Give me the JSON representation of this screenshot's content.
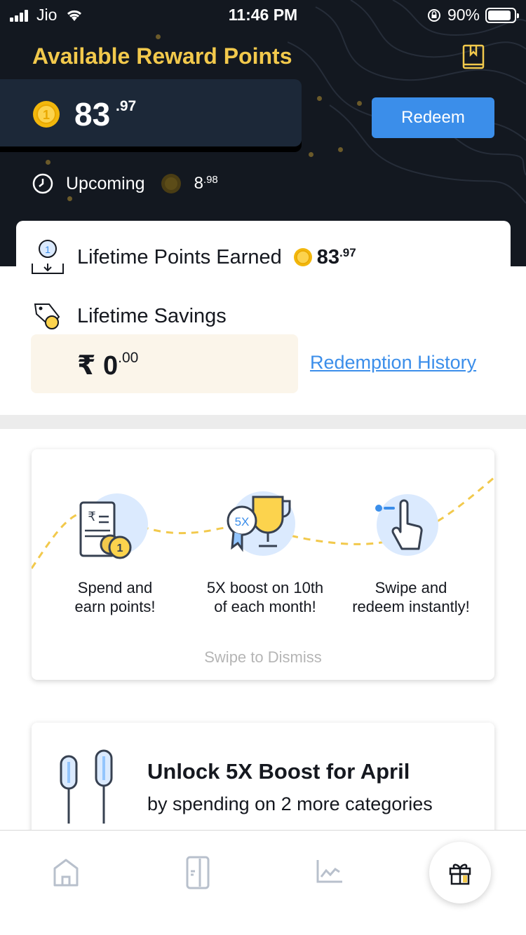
{
  "status_bar": {
    "carrier": "Jio",
    "time": "11:46 PM",
    "battery": "90%"
  },
  "rewards": {
    "title": "Available Reward Points",
    "points_int": "83",
    "points_dec": ".97",
    "redeem_label": "Redeem",
    "upcoming_label": "Upcoming",
    "upcoming_int": "8",
    "upcoming_dec": ".98"
  },
  "lifetime": {
    "points_label": "Lifetime Points Earned",
    "points_int": "83",
    "points_dec": ".97",
    "savings_label": "Lifetime Savings",
    "savings_int": "₹ 0",
    "savings_dec": ".00",
    "history_link": "Redemption History"
  },
  "how_it_works": {
    "steps": [
      {
        "line1": "Spend and",
        "line2": "earn points!",
        "icon": "receipt-coin-icon"
      },
      {
        "line1": "5X boost on 10th",
        "line2": "of each month!",
        "icon": "trophy-5x-icon",
        "badge": "5X"
      },
      {
        "line1": "Swipe and",
        "line2": "redeem instantly!",
        "icon": "swipe-hand-icon"
      }
    ],
    "dismiss_hint": "Swipe to Dismiss"
  },
  "boost_card": {
    "title": "Unlock 5X Boost for April",
    "subtitle": "by spending on 2 more categories",
    "icon": "earphones-icon"
  },
  "tab_bar": {
    "tabs": [
      "home-icon",
      "card-icon",
      "chart-icon",
      "gift-icon"
    ]
  },
  "colors": {
    "hero_bg": "#131820",
    "accent_gold": "#f2c94c",
    "accent_blue": "#3b8eea",
    "savings_bg": "#fbf5ea"
  }
}
